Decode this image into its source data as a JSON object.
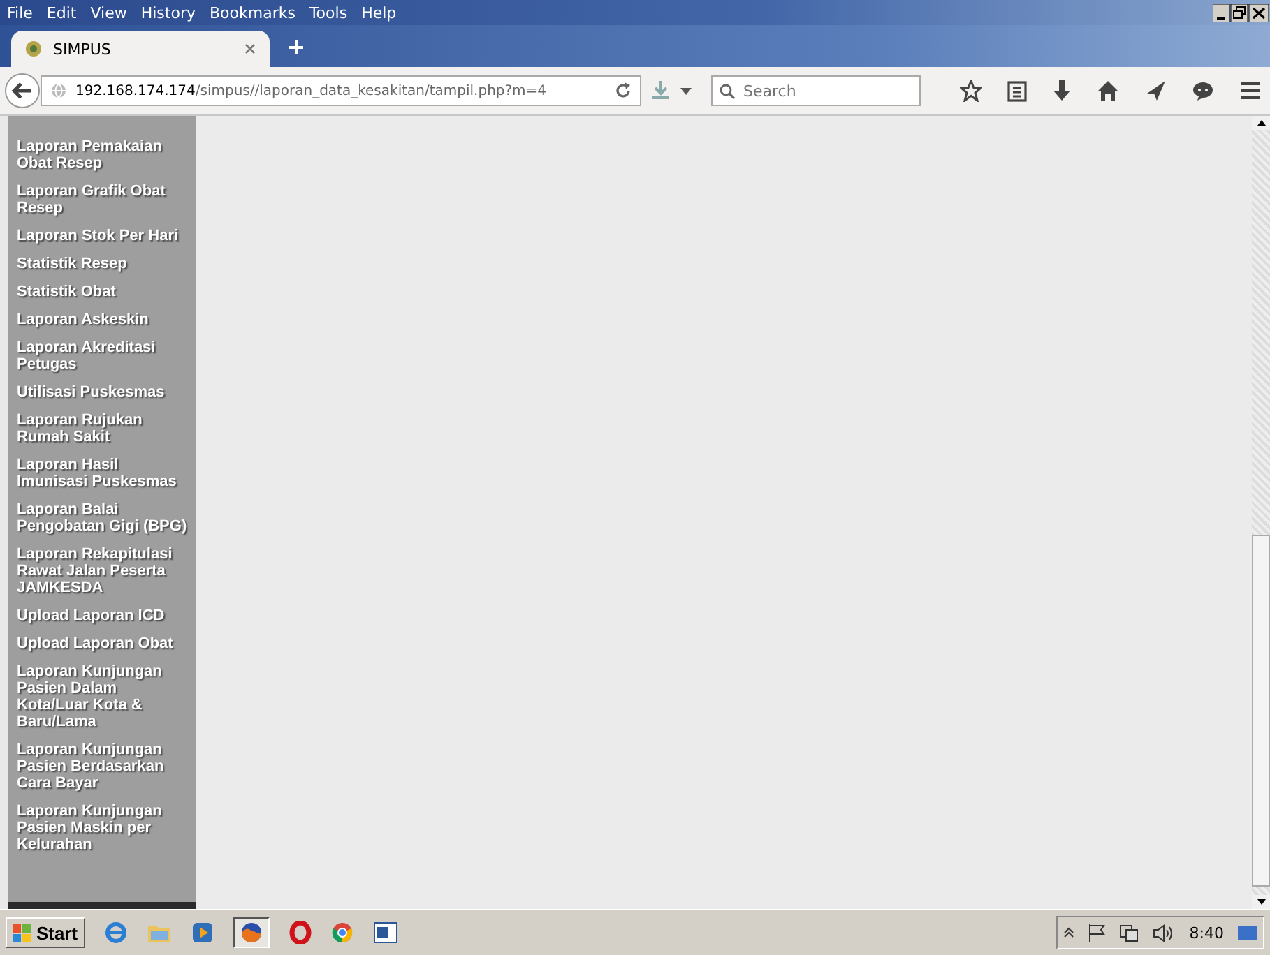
{
  "menu_bar": [
    "File",
    "Edit",
    "View",
    "History",
    "Bookmarks",
    "Tools",
    "Help"
  ],
  "tabs": [
    {
      "title": "SIMPUS",
      "selected": true
    }
  ],
  "address_bar": {
    "host": "192.168.174.174",
    "path": "/simpus//laporan_data_kesakitan/tampil.php?m=4"
  },
  "search": {
    "placeholder": "Search"
  },
  "sidebar": {
    "items": [
      {
        "label": "Laporan Pemakaian\nObat Resep"
      },
      {
        "label": "Laporan Grafik Obat\nResep"
      },
      {
        "label": "Laporan Stok Per Hari"
      },
      {
        "label": "Statistik Resep"
      },
      {
        "label": "Statistik Obat"
      },
      {
        "label": "Laporan Askeskin"
      },
      {
        "label": "Laporan Akreditasi\nPetugas"
      },
      {
        "label": "Utilisasi Puskesmas"
      },
      {
        "label": "Laporan Rujukan\nRumah Sakit"
      },
      {
        "label": "Laporan Hasil\nImunisasi Puskesmas"
      },
      {
        "label": "Laporan Balai\nPengobatan Gigi (BPG)"
      },
      {
        "label": "Laporan Rekapitulasi\nRawat Jalan Peserta\nJAMKESDA"
      },
      {
        "label": "Upload Laporan ICD"
      },
      {
        "label": "Upload Laporan Obat"
      },
      {
        "label": "Laporan Kunjungan\nPasien Dalam\nKota/Luar Kota &\nBaru/Lama"
      },
      {
        "label": "Laporan Kunjungan\nPasien Berdasarkan\nCara Bayar"
      },
      {
        "label": "Laporan Kunjungan\nPasien Maskin per\nKelurahan"
      }
    ]
  },
  "taskbar": {
    "start": "Start",
    "clock": "8:40"
  }
}
